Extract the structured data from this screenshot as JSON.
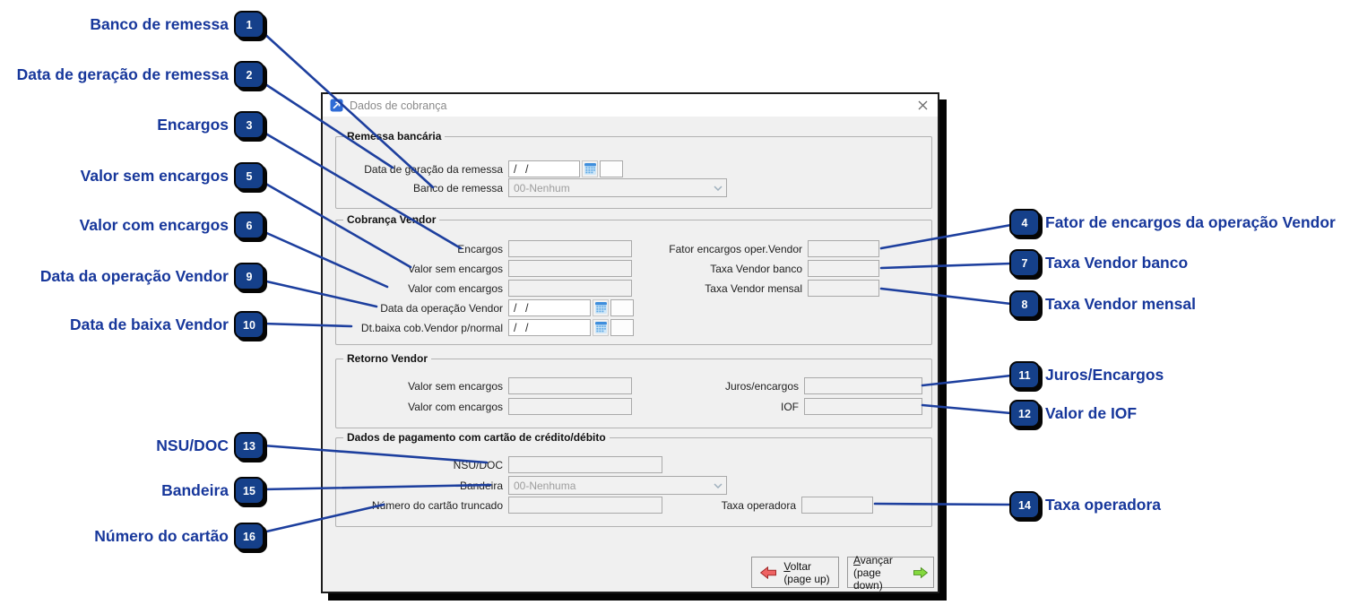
{
  "window": {
    "title": "Dados de cobrança"
  },
  "icons": {
    "titlebar": "app-arrow-up-right-icon",
    "close": "close-x-icon",
    "calendar": "calendar-grid-icon",
    "combo_chevron": "chevron-down-icon",
    "voltar_arrow": "red-arrow-left-icon",
    "avancar_arrow": "green-arrow-right-icon"
  },
  "colors": {
    "callout_text": "#17379b",
    "badge_fill": "#15408a",
    "callout_line": "#1d3f9e",
    "arrow_red": "#ee6262",
    "arrow_green": "#84d83e",
    "titlebar_icon_blue": "#2e6bd6"
  },
  "groups": {
    "remessa": {
      "title": "Remessa bancária",
      "fields": {
        "data_geracao": {
          "label": "Data de geração da remessa",
          "value": "/ /"
        },
        "banco": {
          "label": "Banco de remessa",
          "value": "00-Nenhum"
        }
      }
    },
    "cobranca": {
      "title": "Cobrança Vendor",
      "fields": {
        "encargos": {
          "label": "Encargos",
          "value": ""
        },
        "valor_sem": {
          "label": "Valor sem encargos",
          "value": ""
        },
        "valor_com": {
          "label": "Valor com encargos",
          "value": ""
        },
        "data_operacao": {
          "label": "Data da operação Vendor",
          "value": "/ /"
        },
        "dt_baixa": {
          "label": "Dt.baixa cob.Vendor p/normal",
          "value": "/ /"
        },
        "fator": {
          "label": "Fator encargos oper.Vendor",
          "value": ""
        },
        "taxa_banco": {
          "label": "Taxa Vendor banco",
          "value": ""
        },
        "taxa_mensal": {
          "label": "Taxa Vendor mensal",
          "value": ""
        }
      }
    },
    "retorno": {
      "title": "Retorno Vendor",
      "fields": {
        "valor_sem": {
          "label": "Valor sem encargos",
          "value": ""
        },
        "valor_com": {
          "label": "Valor com encargos",
          "value": ""
        },
        "juros": {
          "label": "Juros/encargos",
          "value": ""
        },
        "iof": {
          "label": "IOF",
          "value": ""
        }
      }
    },
    "cartao": {
      "title": "Dados de pagamento com cartão de crédito/débito",
      "fields": {
        "nsu": {
          "label": "NSU/DOC",
          "value": ""
        },
        "bandeira": {
          "label": "Bandeira",
          "value": "00-Nenhuma"
        },
        "numero": {
          "label": "Número do cartão truncado",
          "value": ""
        },
        "taxa_operadora": {
          "label": "Taxa operadora",
          "value": ""
        }
      }
    }
  },
  "buttons": {
    "voltar": {
      "hotkey": "V",
      "rest": "oltar",
      "sub": "(page up)"
    },
    "avancar": {
      "hotkey": "A",
      "rest": "vançar",
      "sub": "(page down)"
    }
  },
  "callouts": {
    "left": [
      {
        "num": "1",
        "label": "Banco de remessa"
      },
      {
        "num": "2",
        "label": "Data de geração de remessa"
      },
      {
        "num": "3",
        "label": "Encargos"
      },
      {
        "num": "5",
        "label": "Valor sem encargos"
      },
      {
        "num": "6",
        "label": "Valor com encargos"
      },
      {
        "num": "9",
        "label": "Data da operação Vendor"
      },
      {
        "num": "10",
        "label": "Data de baixa Vendor"
      },
      {
        "num": "13",
        "label": "NSU/DOC"
      },
      {
        "num": "15",
        "label": "Bandeira"
      },
      {
        "num": "16",
        "label": "Número do cartão"
      }
    ],
    "right": [
      {
        "num": "4",
        "label": "Fator de encargos da operação Vendor"
      },
      {
        "num": "7",
        "label": "Taxa Vendor banco"
      },
      {
        "num": "8",
        "label": "Taxa Vendor mensal"
      },
      {
        "num": "11",
        "label": "Juros/Encargos"
      },
      {
        "num": "12",
        "label": "Valor de IOF"
      },
      {
        "num": "14",
        "label": "Taxa operadora"
      }
    ]
  }
}
